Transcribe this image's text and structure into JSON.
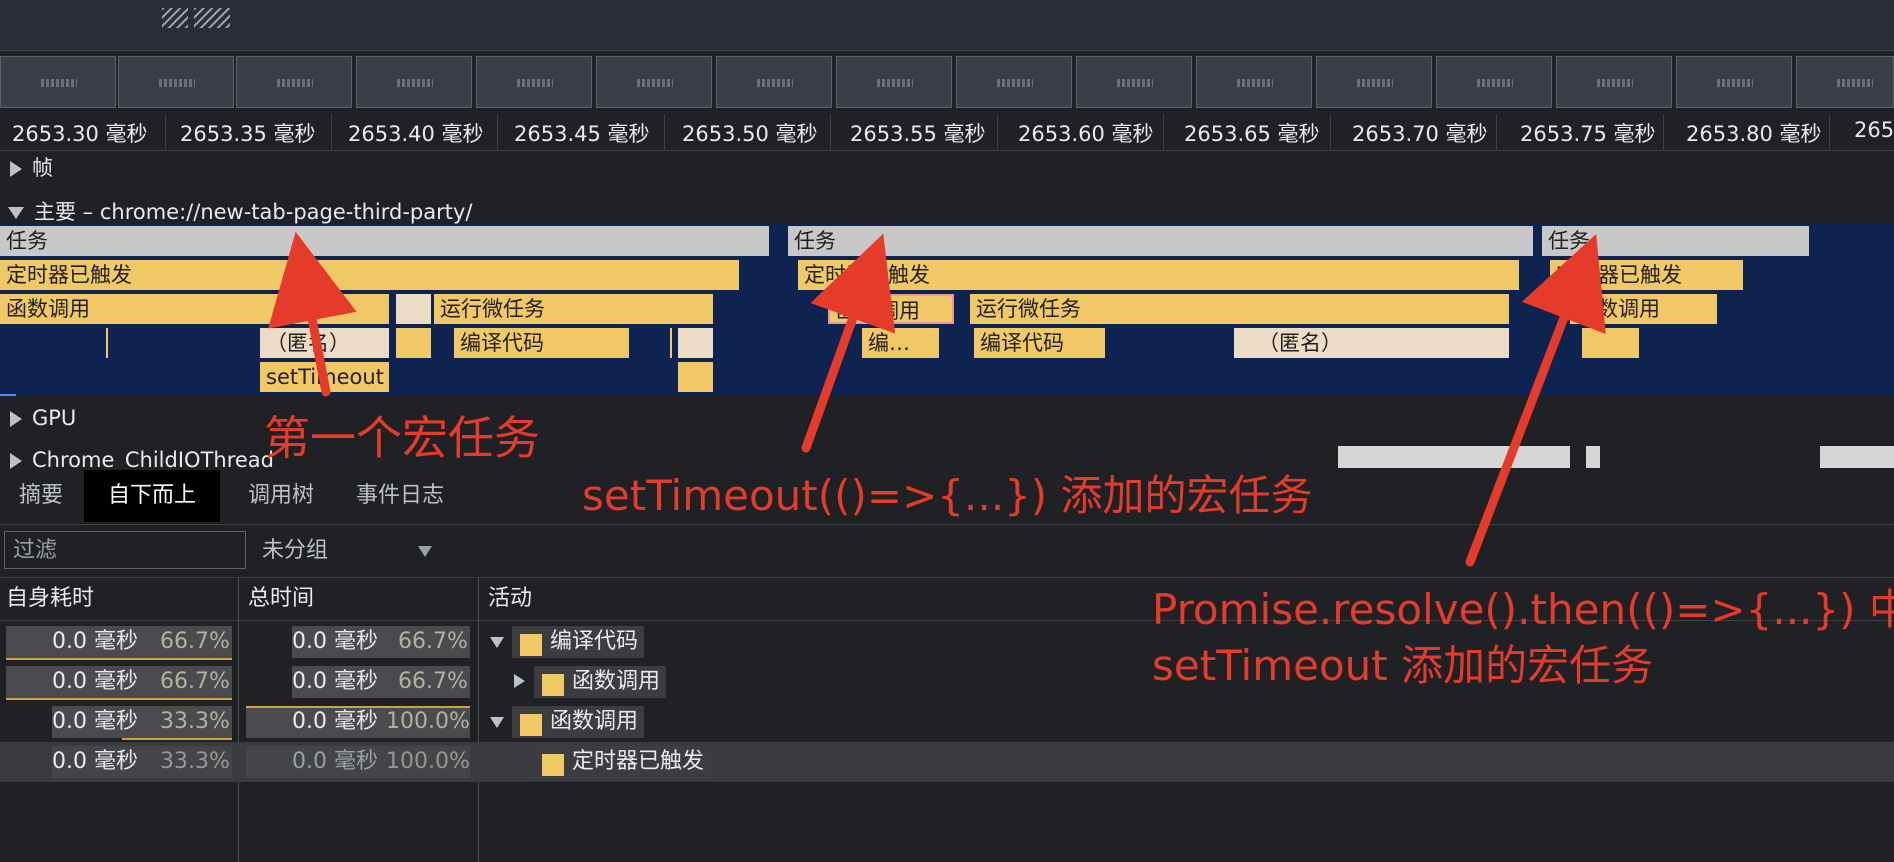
{
  "ruler": {
    "ticks": [
      "2653.30 毫秒",
      "2653.35 毫秒",
      "2653.40 毫秒",
      "2653.45 毫秒",
      "2653.50 毫秒",
      "2653.55 毫秒",
      "2653.60 毫秒",
      "2653.65 毫秒",
      "2653.70 毫秒",
      "2653.75 毫秒",
      "2653.80 毫秒",
      "265"
    ]
  },
  "tracks": {
    "frames": "帧",
    "main": "主要 – chrome://new-tab-page-third-party/",
    "gpu": "GPU",
    "io": "Chrome_ChildIOThread"
  },
  "flame": {
    "task1": "任务",
    "task2": "任务",
    "task3": "任务",
    "timer1": "定时器已触发",
    "timer2": "定时器已触发",
    "timer3": "定时器已触发",
    "func1": "函数调用",
    "microtask1": "运行微任务",
    "anon1": "（匿名）",
    "compile1": "编译代码",
    "settimeout": "setTimeout",
    "func2": "函数调用",
    "microtask2": "运行微任务",
    "compile2a": "编…",
    "compile2b": "编译代码",
    "anon2": "（匿名）",
    "func3": "函数调用"
  },
  "annotations": {
    "first": "第一个宏任务",
    "second": "setTimeout(()=>{...}) 添加的宏任务",
    "third_line1": "Promise.resolve().then(()=>{...}) 中",
    "third_line2": "setTimeout 添加的宏任务",
    "color": "#e53b2b"
  },
  "tabs": [
    "摘要",
    "自下而上",
    "调用树",
    "事件日志"
  ],
  "active_tab": "自下而上",
  "filter": {
    "placeholder": "过滤",
    "group": "未分组"
  },
  "table": {
    "headers": {
      "self": "自身耗时",
      "total": "总时间",
      "activity": "活动"
    },
    "rows": [
      {
        "self_ms": "0.0 毫秒",
        "self_pct": "66.7%",
        "total_ms": "0.0 毫秒",
        "total_pct": "66.7%",
        "activity": "编译代码"
      },
      {
        "self_ms": "0.0 毫秒",
        "self_pct": "66.7%",
        "total_ms": "0.0 毫秒",
        "total_pct": "66.7%",
        "activity": "函数调用"
      },
      {
        "self_ms": "0.0 毫秒",
        "self_pct": "33.3%",
        "total_ms": "0.0 毫秒",
        "total_pct": "100.0%",
        "activity": "函数调用"
      },
      {
        "self_ms": "0.0 毫秒",
        "self_pct": "33.3%",
        "total_ms": "0.0 毫秒",
        "total_pct": "100.0%",
        "activity": "定时器已触发"
      }
    ]
  },
  "colors": {
    "task": "#c8c8c8",
    "scripting": "#f0c865",
    "flame_bg": "#0f2350",
    "active_tab_bg": "#000000"
  }
}
